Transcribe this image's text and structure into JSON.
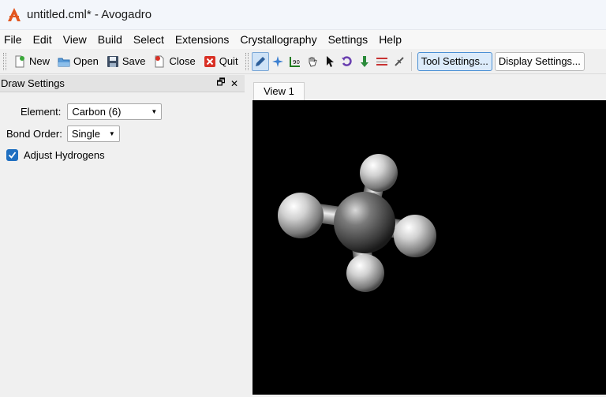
{
  "window": {
    "title": "untitled.cml* - Avogadro"
  },
  "menubar": [
    "File",
    "Edit",
    "View",
    "Build",
    "Select",
    "Extensions",
    "Crystallography",
    "Settings",
    "Help"
  ],
  "toolbar": {
    "new_label": "New",
    "open_label": "Open",
    "save_label": "Save",
    "close_label": "Close",
    "quit_label": "Quit",
    "tool_settings_label": "Tool Settings...",
    "display_settings_label": "Display Settings..."
  },
  "dock": {
    "title": "Draw Settings",
    "element_label": "Element:",
    "element_value": "Carbon (6)",
    "bond_order_label": "Bond Order:",
    "bond_order_value": "Single",
    "adjust_hydrogens_label": "Adjust Hydrogens",
    "adjust_hydrogens_checked": true
  },
  "view": {
    "tab_label": "View 1"
  },
  "colors": {
    "accent": "#1f6fc1",
    "viewport_bg": "#000000"
  }
}
